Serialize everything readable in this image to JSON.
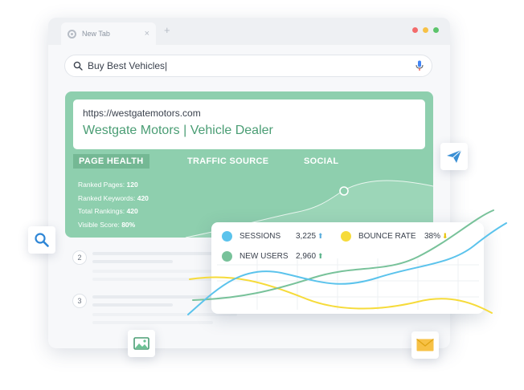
{
  "browser": {
    "tab_title": "New Tab",
    "tab_close": "×",
    "new_tab": "+",
    "window_dots": [
      "#f36b6b",
      "#f7c146",
      "#5cc46b"
    ]
  },
  "search": {
    "query": "Buy Best Vehicles|"
  },
  "result": {
    "url": "https://westgatemotors.com",
    "title": "Westgate Motors | Vehicle Dealer"
  },
  "panel_tabs": [
    {
      "label": "PAGE HEALTH",
      "active": true
    },
    {
      "label": "TRAFFIC SOURCE",
      "active": false
    },
    {
      "label": "SOCIAL",
      "active": false
    }
  ],
  "metrics": [
    {
      "label": "Ranked Pages:",
      "value": "120"
    },
    {
      "label": "Ranked Keywords:",
      "value": "420"
    },
    {
      "label": "Total Rankings:",
      "value": "420"
    },
    {
      "label": "Visible Score:",
      "value": "80%"
    }
  ],
  "list_items": [
    "2",
    "3"
  ],
  "analytics": {
    "legend": [
      {
        "label": "SESSIONS",
        "value": "3,225",
        "trend": "up",
        "color": "#5bc3ec"
      },
      {
        "label": "BOUNCE RATE",
        "value": "38%",
        "trend": "down",
        "color": "#f6db3a"
      },
      {
        "label": "NEW USERS",
        "value": "2,960",
        "trend": "up",
        "color": "#78c29a"
      }
    ],
    "arrows": {
      "up": "⬆",
      "down": "⬇"
    }
  },
  "icons": {
    "send": "send-icon",
    "search": "search-icon",
    "image": "image-icon",
    "mail": "mail-icon"
  },
  "colors": {
    "panel": "#8ecfae",
    "accent_green": "#4a9d74",
    "sessions": "#5bc3ec",
    "new_users": "#78c29a",
    "bounce": "#f6db3a"
  }
}
